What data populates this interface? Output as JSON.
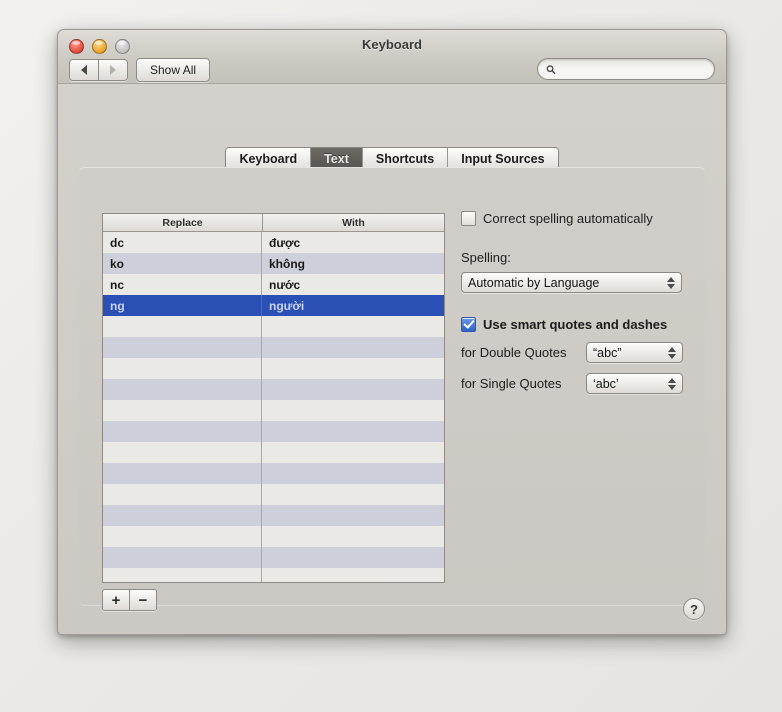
{
  "window": {
    "title": "Keyboard",
    "traffic_lights": [
      "close",
      "minimize",
      "zoom"
    ]
  },
  "toolbar": {
    "back_label": "◀",
    "forward_label": "▶",
    "show_all_label": "Show All",
    "search": {
      "value": "",
      "placeholder": "",
      "icon": "search-icon"
    }
  },
  "tabs": [
    {
      "label": "Keyboard",
      "active": false
    },
    {
      "label": "Text",
      "active": true
    },
    {
      "label": "Shortcuts",
      "active": false
    },
    {
      "label": "Input Sources",
      "active": false
    }
  ],
  "table": {
    "columns": [
      "Replace",
      "With"
    ],
    "rows": [
      {
        "replace": "dc",
        "with": "được",
        "selected": false
      },
      {
        "replace": "ko",
        "with": "không",
        "selected": false
      },
      {
        "replace": "nc",
        "with": "nước",
        "selected": false
      },
      {
        "replace": "ng",
        "with": "người",
        "selected": true
      }
    ],
    "empty_row_count": 13
  },
  "actions": {
    "add_label": "+",
    "remove_label": "−"
  },
  "options": {
    "correct_spelling": {
      "label": "Correct spelling automatically",
      "checked": false
    },
    "spelling_section_label": "Spelling:",
    "spelling_popup": {
      "value": "Automatic by Language"
    },
    "smart_quotes": {
      "label": "Use smart quotes and dashes",
      "checked": true
    },
    "double_quotes": {
      "label": "for Double Quotes",
      "value": "“abc”"
    },
    "single_quotes": {
      "label": "for Single Quotes",
      "value": "‘abc’"
    }
  },
  "help": {
    "label": "?"
  },
  "colors": {
    "selection_blue": "#2a4fb5",
    "row_stripe_light": "#eae9e6",
    "row_stripe_blue": "#cdd0da",
    "window_chrome": "#d6d3ce"
  }
}
